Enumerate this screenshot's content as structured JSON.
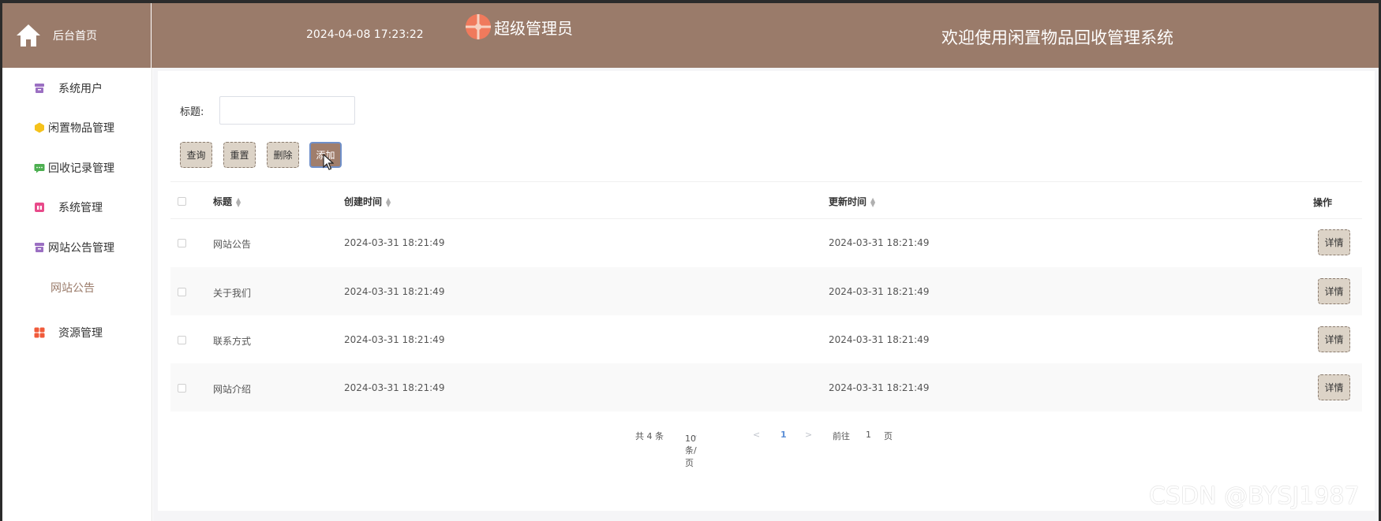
{
  "header": {
    "home_label": "后台首页",
    "datetime": "2024-04-08 17:23:22",
    "admin_name": "超级管理员",
    "system_title": "欢迎使用闲置物品回收管理系统"
  },
  "sidebar": {
    "items": [
      {
        "label": "系统用户",
        "icon": "archive-icon",
        "color": "#9b6fc2"
      },
      {
        "label": "闲置物品管理",
        "icon": "hexagon-icon",
        "color": "#f5c21b"
      },
      {
        "label": "回收记录管理",
        "icon": "chat-icon",
        "color": "#4caf50"
      },
      {
        "label": "系统管理",
        "icon": "gift-icon",
        "color": "#e84a8a"
      },
      {
        "label": "网站公告管理",
        "icon": "archive-icon",
        "color": "#9b6fc2"
      },
      {
        "label": "网站公告",
        "icon": "",
        "color": "#9a7b6a"
      },
      {
        "label": "资源管理",
        "icon": "grid-icon",
        "color": "#f05a3a"
      }
    ]
  },
  "search": {
    "label": "标题:",
    "value": "",
    "placeholder": ""
  },
  "toolbar": {
    "query_label": "查询",
    "reset_label": "重置",
    "delete_label": "删除",
    "add_label": "添加"
  },
  "table": {
    "headers": {
      "title": "标题",
      "created": "创建时间",
      "updated": "更新时间",
      "actions": "操作"
    },
    "rows": [
      {
        "title": "网站公告",
        "created": "2024-03-31 18:21:49",
        "updated": "2024-03-31 18:21:49",
        "action": "详情"
      },
      {
        "title": "关于我们",
        "created": "2024-03-31 18:21:49",
        "updated": "2024-03-31 18:21:49",
        "action": "详情"
      },
      {
        "title": "联系方式",
        "created": "2024-03-31 18:21:49",
        "updated": "2024-03-31 18:21:49",
        "action": "详情"
      },
      {
        "title": "网站介绍",
        "created": "2024-03-31 18:21:49",
        "updated": "2024-03-31 18:21:49",
        "action": "详情"
      }
    ]
  },
  "pagination": {
    "total": "共 4 条",
    "page_size": "10条/页",
    "prev": "<",
    "current": "1",
    "next": ">",
    "goto_label": "前往",
    "goto_value": "1",
    "page_suffix": "页"
  },
  "watermark": "CSDN @BYSJ1987",
  "colors": {
    "header_bg": "#9a7b6a",
    "button_bg": "#dcd3c7",
    "primary_button_bg": "#a07e6c",
    "active_page": "#5b8ed6"
  }
}
